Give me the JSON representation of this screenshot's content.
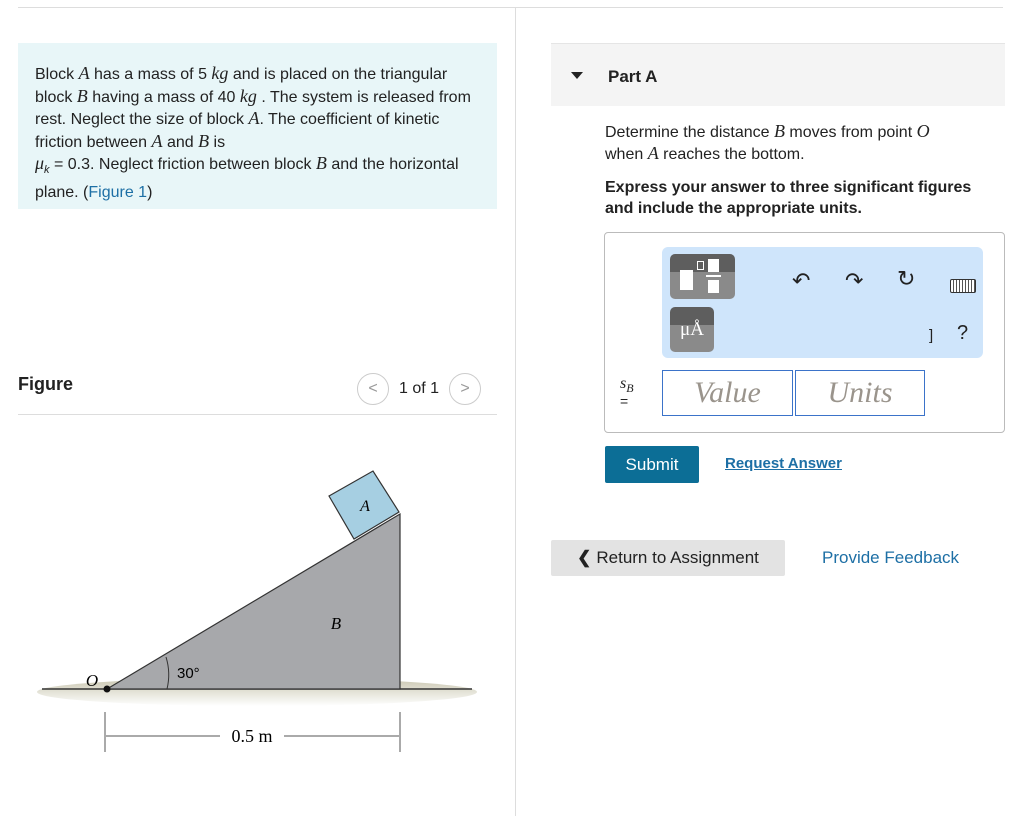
{
  "problem": {
    "t1": "Block ",
    "A": "A",
    "t2": " has a mass of 5 ",
    "kg": "kg",
    "t3": " and is placed on the triangular block ",
    "B": "B",
    "t4": " having a mass of 40 ",
    "kg2": "kg",
    "t5": " . The system is released from rest. Neglect the size of block ",
    "A2": "A",
    "t6": ". The coefficient of kinetic friction between ",
    "A3": "A",
    "t7": " and ",
    "B2": "B",
    "t8": " is ",
    "mu": "μ",
    "muk": "k",
    "t9": " = 0.3. Neglect friction between block ",
    "B3": "B",
    "t10": " and the horizontal plane. (",
    "figlink": "Figure 1",
    "t11": ")"
  },
  "figure": {
    "title": "Figure",
    "pager": "1 of 1",
    "prev": "<",
    "next": ">",
    "labels": {
      "A": "A",
      "B": "B",
      "O": "O",
      "angle": "30°",
      "dim": "0.5 m"
    },
    "colors": {
      "block_a": "#a6cfe2",
      "block_b": "#a7a8ab"
    }
  },
  "part": {
    "label": "Part A",
    "q1": "Determine the distance ",
    "qB": "B",
    "q2": " moves from point ",
    "qO": "O",
    "q3": " when ",
    "qA": "A",
    "q4": " reaches the bottom.",
    "instructions": "Express your answer to three significant figures and include the appropriate units.",
    "var": "s",
    "var_sub": "B",
    "eq": "=",
    "value_placeholder": "Value",
    "units_placeholder": "Units",
    "unit_btn": "μÅ",
    "help": "?",
    "bracket": "]",
    "submit": "Submit",
    "request": "Request Answer"
  },
  "footer": {
    "return": "Return to Assignment",
    "feedback": "Provide Feedback"
  }
}
